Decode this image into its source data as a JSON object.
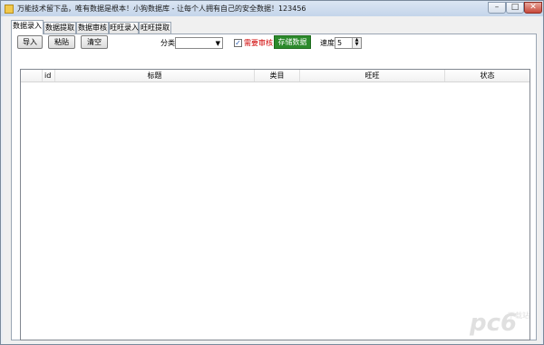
{
  "window": {
    "title": "万能技术留下品，唯有数据是根本！小狗数据库 - 让每个人拥有自己的安全数据！123456",
    "controls": [
      "–",
      "□",
      "✕"
    ]
  },
  "tabs": [
    "数据录入",
    "数据提取",
    "数据审核",
    "旺旺录入",
    "旺旺提取"
  ],
  "toolbar": {
    "import_label": "导入",
    "paste_label": "粘贴",
    "clear_label": "清空",
    "category_label": "分类",
    "category_value": "",
    "review_label": "需要审核",
    "review_checked": true,
    "store_label": "存储数据",
    "speed_label": "速度",
    "speed_value": "5"
  },
  "grid": {
    "columns": [
      "id",
      "标题",
      "类目",
      "旺旺",
      "状态"
    ],
    "rows": []
  },
  "watermark": {
    "text": "pc6",
    "sub": "下载站"
  },
  "colors": {
    "store_button": "#2c8a2c",
    "review_label": "#d00000",
    "watermark": "#e0e0e0"
  }
}
